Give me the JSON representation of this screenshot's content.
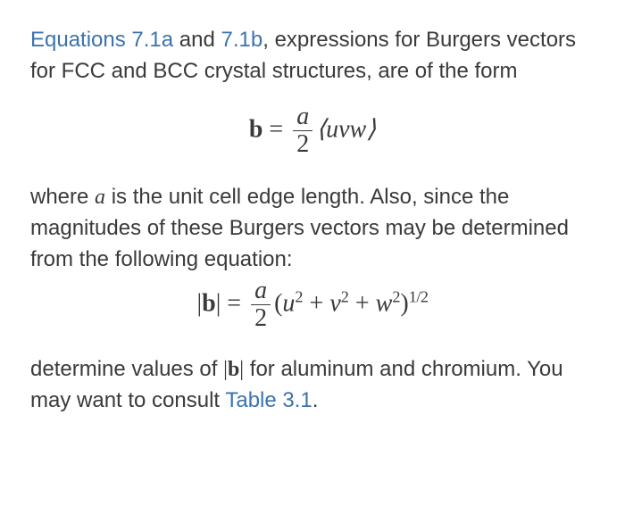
{
  "p1": {
    "link1": "Equations 7.1a",
    "mid1": " and ",
    "link2": "7.1b",
    "rest": ", expressions for Burgers vectors for FCC and BCC crystal structures, are of the form"
  },
  "eq1": {
    "lhs": "b",
    "eq": " = ",
    "frac_num": "a",
    "frac_den": "2",
    "rhs": "⟨uvw⟩"
  },
  "p2": {
    "pre": "where ",
    "a": "a",
    "rest": " is the unit cell edge length. Also, since the magnitudes of these Burgers vectors may be determined from the following equation:"
  },
  "eq2": {
    "lhs": "|b|",
    "eq": " = ",
    "frac_num": "a",
    "frac_den": "2",
    "open": "(",
    "u": "u",
    "plus": " + ",
    "v": "v",
    "w": "w",
    "close": ")",
    "sq": "2",
    "exp": "1/2"
  },
  "p3": {
    "pre": "determine values of ",
    "b": "|b|",
    "mid": " for aluminum and chromium. You may want to consult ",
    "link": "Table 3.1",
    "dot": "."
  }
}
